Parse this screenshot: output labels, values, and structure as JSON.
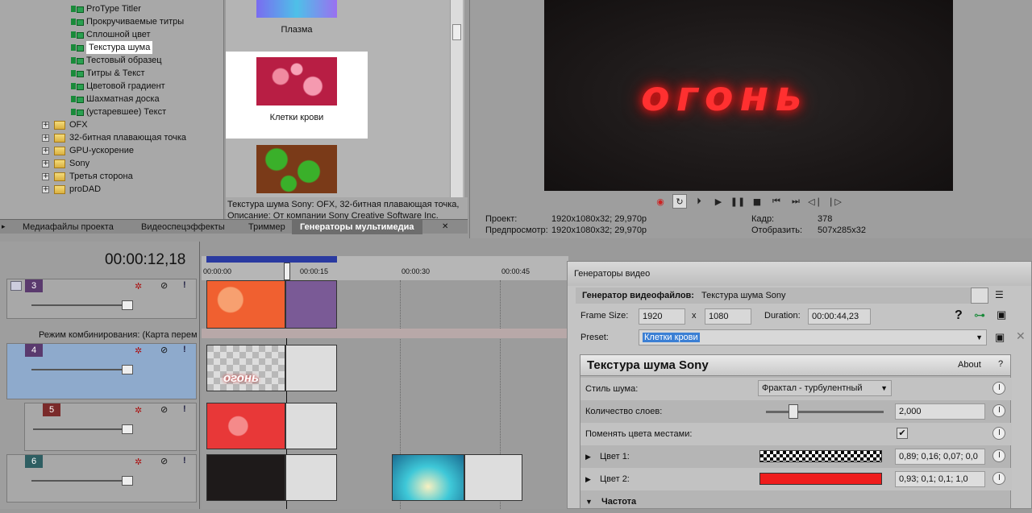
{
  "tree": {
    "items": [
      "ProType Titler",
      "Прокручиваемые титры",
      "Сплошной цвет",
      "Текстура шума",
      "Тестовый образец",
      "Титры & Текст",
      "Цветовой градиент",
      "Шахматная доска",
      "(устаревшее) Текст"
    ],
    "folders": [
      "OFX",
      "32-битная плавающая точка",
      "GPU-ускорение",
      "Sony",
      "Третья сторона",
      "proDAD"
    ],
    "expand_glyph": "+"
  },
  "thumbs": {
    "plasma": "Плазма",
    "blood": "Клетки крови"
  },
  "desc": {
    "line1": "Текстура шума Sony: OFX, 32-битная плавающая точка,",
    "line2": "Описание: От компании Sony Creative Software Inc."
  },
  "tabs": [
    "Медиафайлы проекта",
    "Видеоспецэффекты",
    "Триммер",
    "Генераторы мультимедиа"
  ],
  "preview": {
    "video_text": "огонь",
    "project_label": "Проект:",
    "project_val": "1920x1080x32; 29,970p",
    "preview_label": "Предпросмотр:",
    "preview_val": "1920x1080x32; 29,970p",
    "frame_label": "Кадр:",
    "frame_val": "378",
    "display_label": "Отобразить:",
    "display_val": "507x285x32"
  },
  "timeline": {
    "timecode": "00:00:12,18",
    "ruler": [
      "00:00:00",
      "00:00:15",
      "00:00:30",
      "00:00:45"
    ],
    "track_numbers": [
      "3",
      "4",
      "5",
      "6"
    ],
    "blend_mode": "Режим комбинирования: (Карта перем",
    "clip_text": "огонь"
  },
  "gen": {
    "title": "Генераторы видео",
    "generator_label": "Генератор видеофайлов:",
    "generator_name": "Текстура шума Sony",
    "frame_size_label": "Frame Size:",
    "width": "1920",
    "x": "x",
    "height": "1080",
    "duration_label": "Duration:",
    "duration": "00:00:44,23",
    "preset_label": "Preset:",
    "preset": "Клетки крови",
    "panel_title": "Текстура шума Sony",
    "about": "About",
    "help": "?",
    "noise_style_label": "Стиль шума:",
    "noise_style": "Фрактал - турбулентный",
    "layers_label": "Количество слоев:",
    "layers": "2,000",
    "swap_label": "Поменять цвета местами:",
    "color1_label": "Цвет 1:",
    "color1_val": "0,89; 0,16; 0,07; 0,0",
    "color2_label": "Цвет 2:",
    "color2_val": "0,93; 0,1; 0,1; 1,0",
    "freq_label": "Частота"
  },
  "colors": {
    "red": "#ef1c1c",
    "accent": "#4070c8"
  }
}
